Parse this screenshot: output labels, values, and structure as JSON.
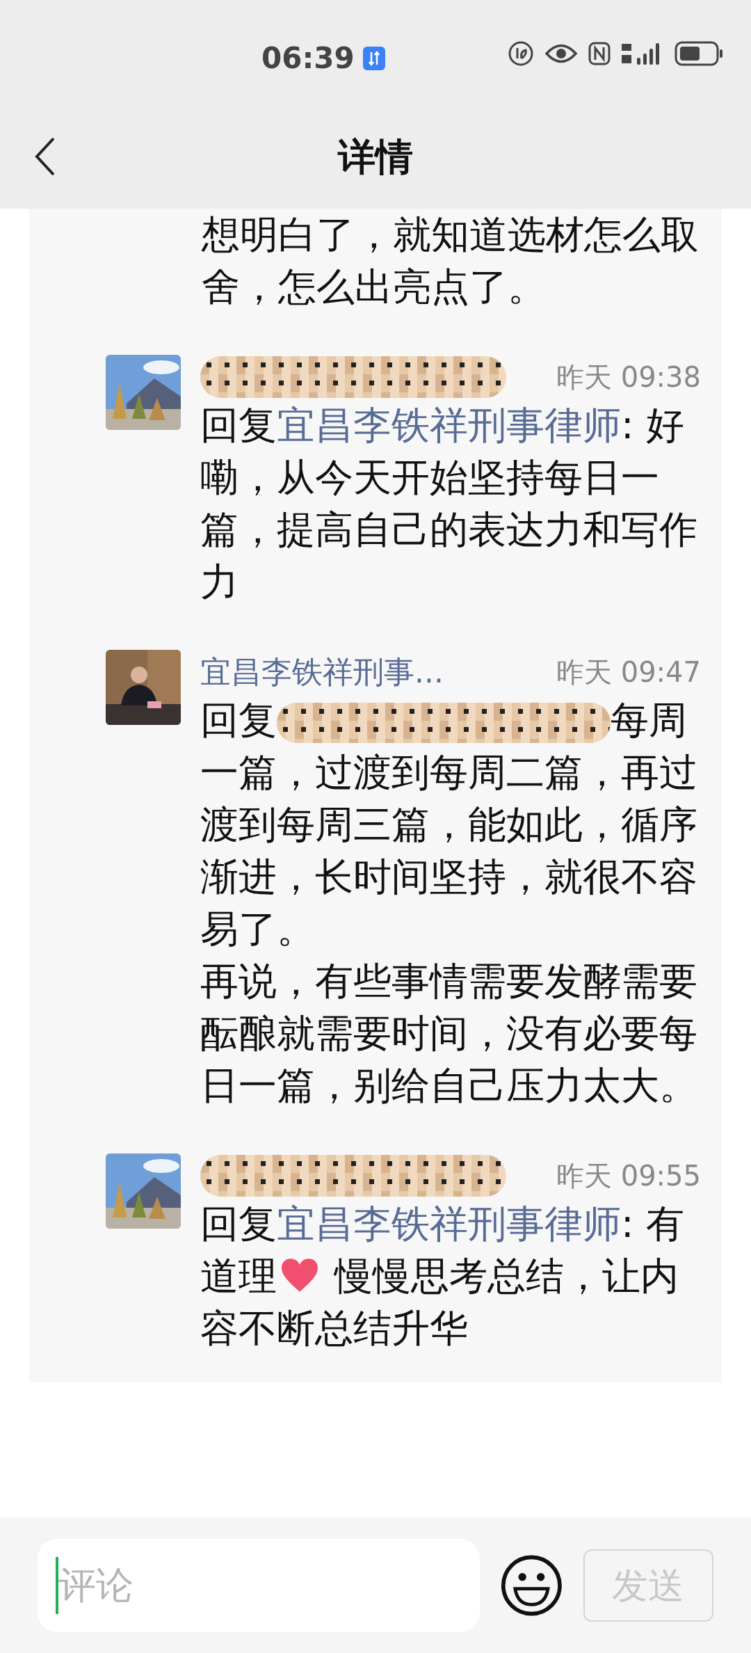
{
  "status_bar": {
    "time": "06:39"
  },
  "header": {
    "title": "详情"
  },
  "comments": [
    {
      "body": [
        {
          "kind": "text",
          "text": "想明白了，就知道选材怎么取舍，怎么出亮点了。"
        }
      ]
    },
    {
      "avatar": {
        "kind": "picture"
      },
      "name": {
        "kind": "mosaic"
      },
      "time": "昨天 09:38",
      "body": [
        {
          "kind": "text",
          "text": "回复"
        },
        {
          "kind": "mention",
          "text": "宜昌李铁祥刑事律师"
        },
        {
          "kind": "text",
          "text": ": 好嘞，从今天开始坚持每日一篇，提高自己的表达力和写作力"
        }
      ]
    },
    {
      "avatar": {
        "kind": "picture"
      },
      "name": {
        "kind": "text",
        "text": "宜昌李铁祥刑事..."
      },
      "time": "昨天 09:47",
      "body": [
        {
          "kind": "text",
          "text": "回复"
        },
        {
          "kind": "mosaic"
        },
        {
          "kind": "text",
          "text": "每周一篇，过渡到每周二篇，再过渡到每周三篇，能如此，循序渐进，长时间坚持，就很不容易了。"
        },
        {
          "kind": "break"
        },
        {
          "kind": "text",
          "text": "再说，有些事情需要发酵需要酝酿就需要时间，没有必要每日一篇，别给自己压力太大。"
        }
      ]
    },
    {
      "avatar": {
        "kind": "picture"
      },
      "name": {
        "kind": "mosaic"
      },
      "time": "昨天 09:55",
      "body": [
        {
          "kind": "text",
          "text": "回复"
        },
        {
          "kind": "mention",
          "text": "宜昌李铁祥刑事律师"
        },
        {
          "kind": "text",
          "text": ": 有道理"
        },
        {
          "kind": "heart"
        },
        {
          "kind": "text",
          "text": " 慢慢思考总结，让内容不断总结升华"
        }
      ]
    }
  ],
  "composer": {
    "placeholder": "评论",
    "send": {
      "label": "发送",
      "disabled": true
    }
  }
}
